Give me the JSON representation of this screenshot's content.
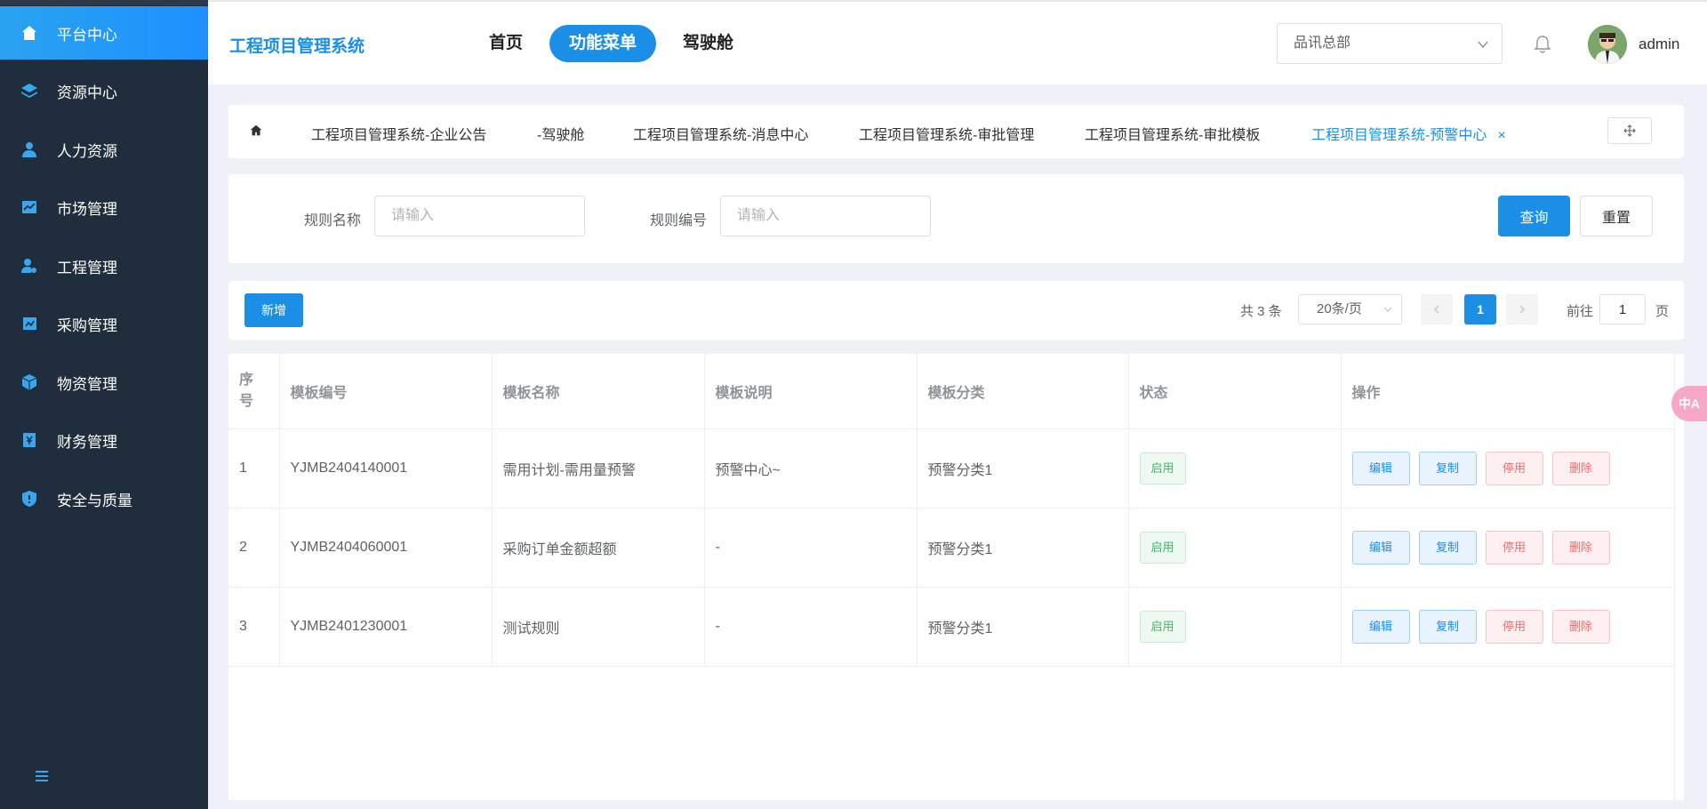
{
  "sidebar": {
    "items": [
      {
        "label": "平台中心",
        "icon": "home-icon"
      },
      {
        "label": "资源中心",
        "icon": "layers-icon"
      },
      {
        "label": "人力资源",
        "icon": "user-icon"
      },
      {
        "label": "市场管理",
        "icon": "chart-icon"
      },
      {
        "label": "工程管理",
        "icon": "engineer-icon"
      },
      {
        "label": "采购管理",
        "icon": "purchase-icon"
      },
      {
        "label": "物资管理",
        "icon": "cube-icon"
      },
      {
        "label": "财务管理",
        "icon": "finance-icon"
      },
      {
        "label": "安全与质量",
        "icon": "shield-icon"
      }
    ],
    "active_index": 0
  },
  "header": {
    "app_title": "工程项目管理系统",
    "nav": [
      "首页",
      "功能菜单",
      "驾驶舱"
    ],
    "nav_active": 1,
    "org": "品讯总部",
    "username": "admin"
  },
  "tabs": {
    "items": [
      "工程项目管理系统-企业公告",
      "-驾驶舱",
      "工程项目管理系统-消息中心",
      "工程项目管理系统-审批管理",
      "工程项目管理系统-审批模板",
      "工程项目管理系统-预警中心"
    ],
    "close_symbol": "×"
  },
  "search": {
    "rule_name_label": "规则名称",
    "rule_name_placeholder": "请输入",
    "rule_code_label": "规则编号",
    "rule_code_placeholder": "请输入",
    "query_label": "查询",
    "reset_label": "重置"
  },
  "toolbar": {
    "add_label": "新增",
    "total": "共 3 条",
    "page_size": "20条/页",
    "current_page": "1",
    "goto_prefix": "前往",
    "goto_value": "1",
    "goto_suffix": "页"
  },
  "table": {
    "headers": [
      "序号",
      "模板编号",
      "模板名称",
      "模板说明",
      "模板分类",
      "状态",
      "操作"
    ],
    "rows": [
      {
        "seq": "1",
        "code": "YJMB2404140001",
        "name": "需用计划-需用量预警",
        "desc": "预警中心~",
        "category": "预警分类1",
        "status": "启用"
      },
      {
        "seq": "2",
        "code": "YJMB2404060001",
        "name": "采购订单金额超额",
        "desc": "-",
        "category": "预警分类1",
        "status": "启用"
      },
      {
        "seq": "3",
        "code": "YJMB2401230001",
        "name": "测试规则",
        "desc": "-",
        "category": "预警分类1",
        "status": "启用"
      }
    ],
    "actions": {
      "edit": "编辑",
      "copy": "复制",
      "disable": "停用",
      "delete": "删除"
    }
  },
  "translate_bubble": "中A",
  "colors": {
    "sidebar_bg": "#1f2d3d",
    "accent": "#1b8fe6",
    "success": "#3fb865",
    "danger": "#f56c6c"
  }
}
